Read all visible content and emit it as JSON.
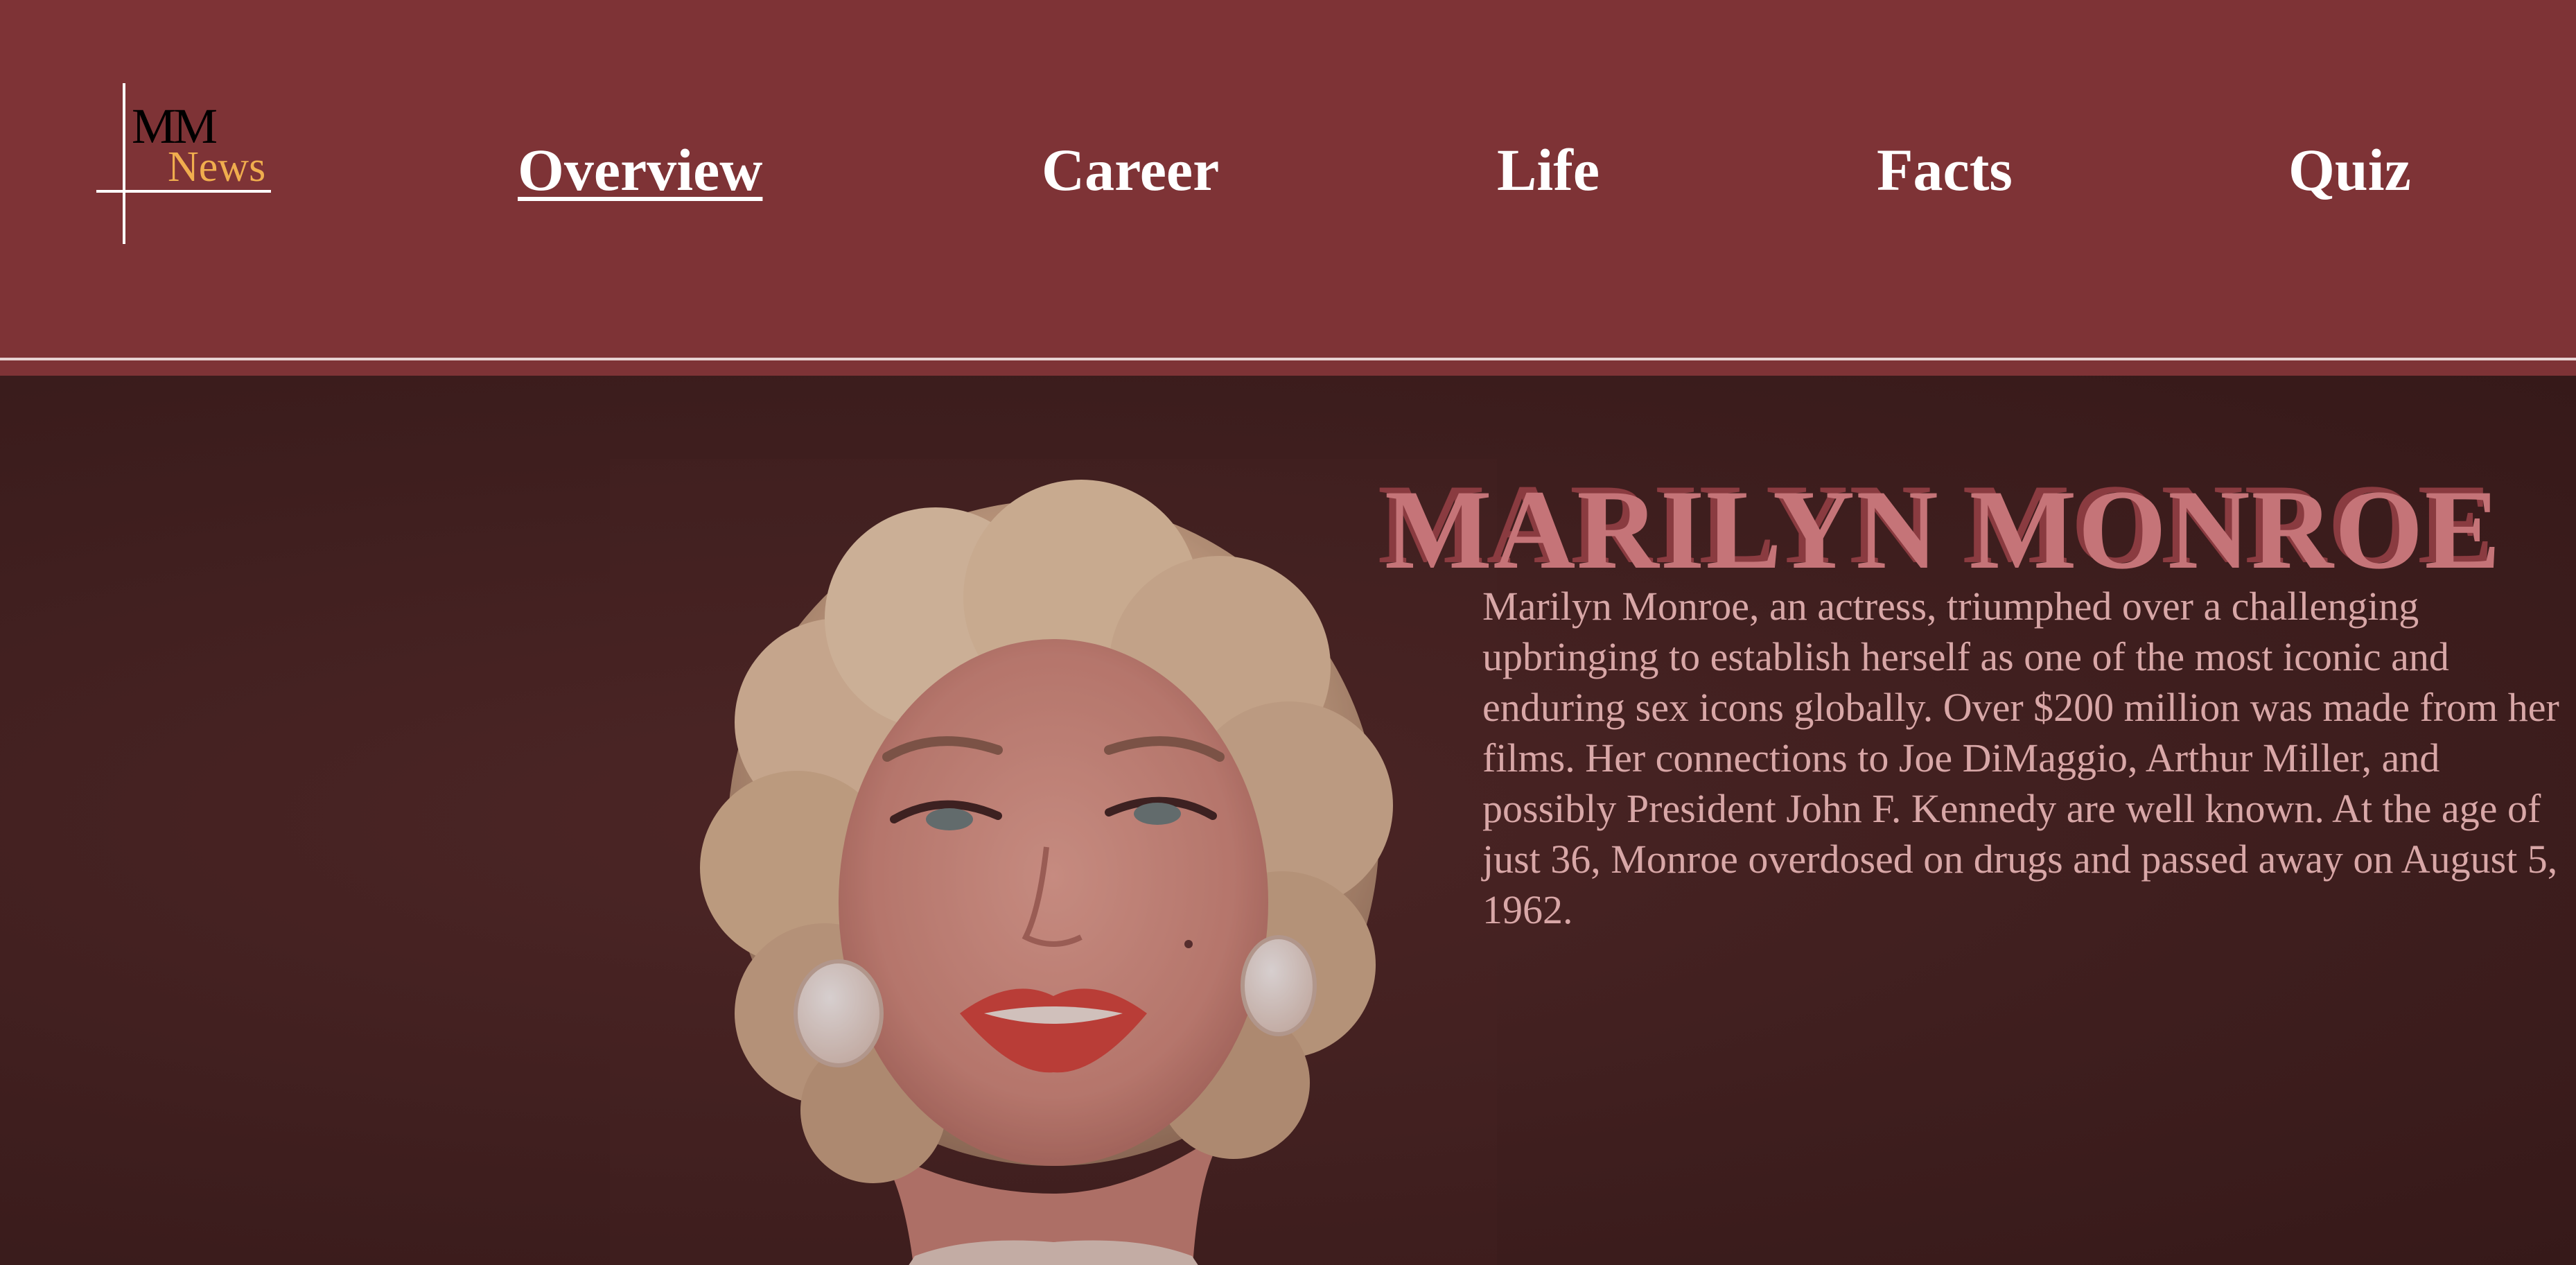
{
  "logo": {
    "mm": "MM",
    "news": "News"
  },
  "nav": {
    "items": [
      {
        "label": "Overview",
        "active": true
      },
      {
        "label": "Career",
        "active": false
      },
      {
        "label": "Life",
        "active": false
      },
      {
        "label": "Facts",
        "active": false
      },
      {
        "label": "Quiz",
        "active": false
      }
    ]
  },
  "hero": {
    "title": "MARILYN MONROE",
    "description": "Marilyn Monroe, an actress, triumphed over a challenging upbringing to establish herself as one of the most iconic and enduring sex icons globally. Over $200 million was made from her films. Her connections to Joe DiMaggio, Arthur Miller, and possibly President John F. Kennedy are well known. At the age of just 36, Monroe overdosed on drugs and passed away on August 5, 1962."
  },
  "colors": {
    "header_bg": "#7e3336",
    "hero_bg": "#3e1e1e",
    "title": "#c57478",
    "title_shadow": "#8a3b40",
    "body_text": "#d8a7a7",
    "logo_news": "#f0ad4e",
    "nav_text": "#ffffff"
  }
}
